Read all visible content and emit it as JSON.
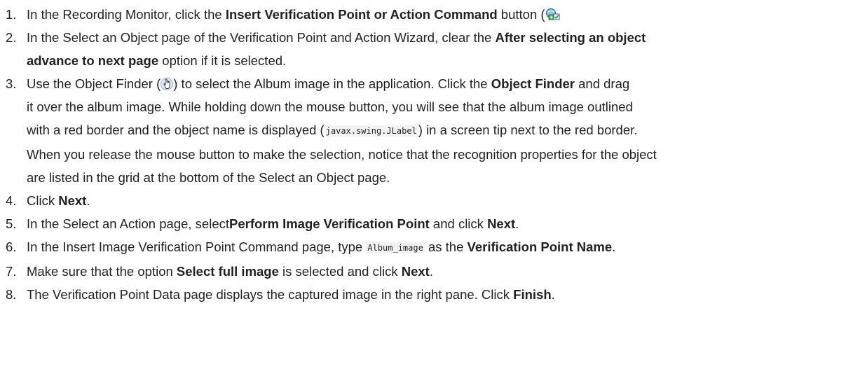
{
  "steps": [
    {
      "num": "1.",
      "t1": "In the Recording Monitor, click the ",
      "b1": "Insert Verification Point or Action Command",
      "t2": " button (",
      "icon": "insert-verification-point-icon"
    },
    {
      "num": "2.",
      "t1": "In the Select an Object page of the Verification Point and Action Wizard, clear the ",
      "b1": "After selecting an object",
      "b2": "advance to next page",
      "t2": " option if it is selected."
    },
    {
      "num": "3.",
      "t1": "Use the Object Finder (",
      "icon": "object-finder-hand-icon",
      "t2": ") to select the Album image in the application. Click the ",
      "b1": "Object Finder",
      "t3": " and drag",
      "l2": "it over the album image. While holding down the mouse button, you will see that the album image outlined",
      "l3a": "with a red border and the object name is displayed (",
      "code": "javax.swing.JLabel",
      "l3b": ") in a screen tip next to the red border.",
      "l4": "When you release the mouse button to make the selection, notice that the recognition properties for the object",
      "l5": "are listed in the grid at the bottom of the Select an Object page."
    },
    {
      "num": "4.",
      "t1": "Click ",
      "b1": "Next",
      "t2": "."
    },
    {
      "num": "5.",
      "t1": "In the Select an Action page, select",
      "b1": "Perform Image Verification Point",
      "t2": " and click ",
      "b2": "Next",
      "t3": "."
    },
    {
      "num": "6.",
      "t1": "In the Insert Image Verification Point Command page, type ",
      "code": "Album_image",
      "t2": " as the ",
      "b1": "Verification Point Name",
      "t3": "."
    },
    {
      "num": "7.",
      "t1": "Make sure that the option ",
      "b1": "Select full image",
      "t2": " is selected and click ",
      "b2": "Next",
      "t3": "."
    },
    {
      "num": "8.",
      "t1": "The Verification Point Data page displays the captured image in the right pane. Click ",
      "b1": "Finish",
      "t2": "."
    }
  ]
}
